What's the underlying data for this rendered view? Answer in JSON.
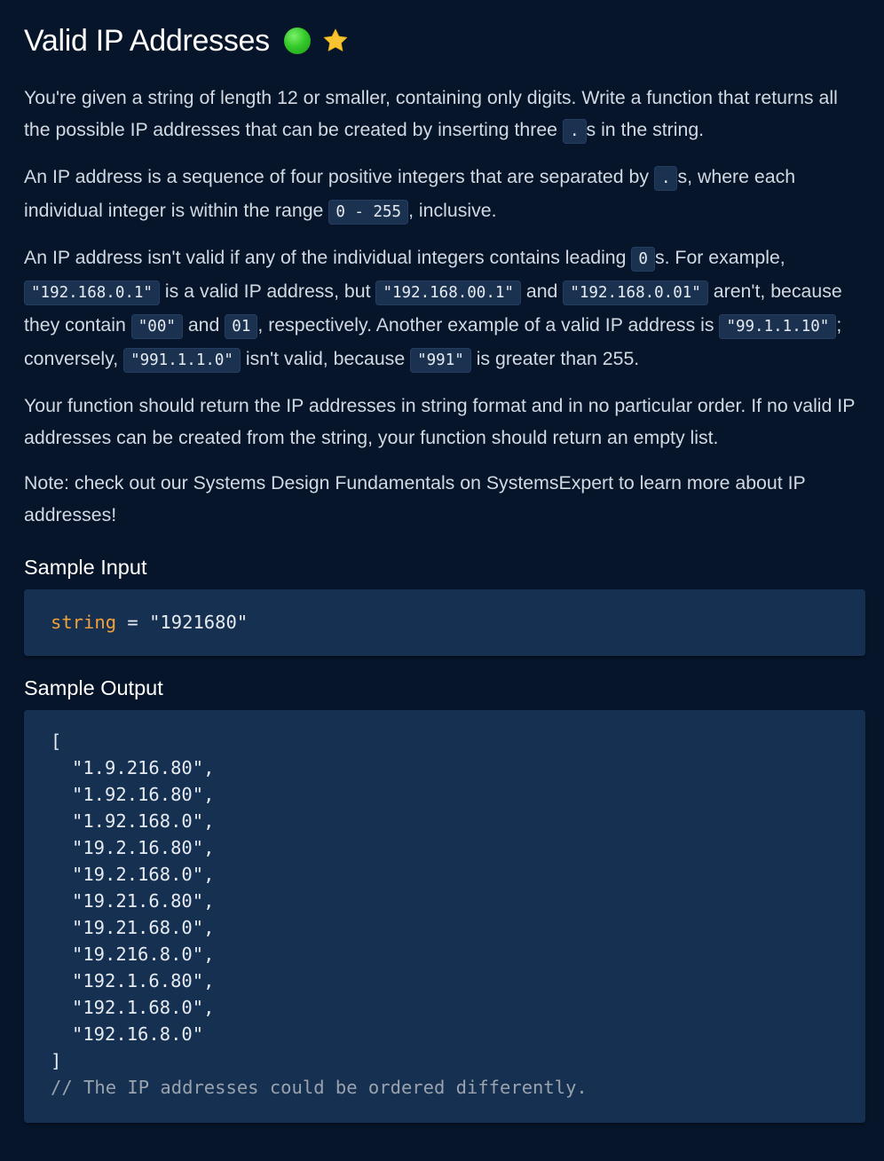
{
  "header": {
    "title": "Valid IP Addresses",
    "difficulty_icon": "green-circle-icon",
    "favorite_icon": "star-icon"
  },
  "description": {
    "p1": {
      "t1": "You're given a string of length 12 or smaller, containing only digits. Write a function that returns all the possible IP addresses that can be created by inserting three ",
      "c1": ".",
      "t2": "s in the string."
    },
    "p2": {
      "t1": "An IP address is a sequence of four positive integers that are separated by ",
      "c1": ".",
      "t2": "s, where each individual integer is within the range ",
      "c2": "0 - 255",
      "t3": ", inclusive."
    },
    "p3": {
      "t1": "An IP address isn't valid if any of the individual integers contains leading ",
      "c1": "0",
      "t2": "s. For example, ",
      "c2": "\"192.168.0.1\"",
      "t3": " is a valid IP address, but ",
      "c3": "\"192.168.00.1\"",
      "t4": " and ",
      "c4": "\"192.168.0.01\"",
      "t5": " aren't, because they contain ",
      "c5": "\"00\"",
      "t6": " and ",
      "c6": "01",
      "t7": ", respectively. Another example of a valid IP address is ",
      "c7": "\"99.1.1.10\"",
      "t8": "; conversely, ",
      "c8": "\"991.1.1.0\"",
      "t9": " isn't valid, because ",
      "c9": "\"991\"",
      "t10": " is greater than 255."
    },
    "p4": "Your function should return the IP addresses in string format and in no particular order. If no valid IP addresses can be created from the string, your function should return an empty list.",
    "p5": "Note: check out our Systems Design Fundamentals on SystemsExpert to learn more about IP addresses!"
  },
  "sample_input": {
    "heading": "Sample Input",
    "keyword": "string",
    "rest": " = \"1921680\""
  },
  "sample_output": {
    "heading": "Sample Output",
    "open": "[",
    "items": [
      "\"1.9.216.80\",",
      "\"1.92.16.80\",",
      "\"1.92.168.0\",",
      "\"19.2.16.80\",",
      "\"19.2.168.0\",",
      "\"19.21.6.80\",",
      "\"19.21.68.0\",",
      "\"19.216.8.0\",",
      "\"192.1.6.80\",",
      "\"192.1.68.0\",",
      "\"192.16.8.0\""
    ],
    "close": "]",
    "comment": "// The IP addresses could be ordered differently."
  },
  "colors": {
    "background": "#06152a",
    "code_block": "#163052",
    "keyword": "#f0a13a",
    "comment": "#9aa3ad"
  }
}
